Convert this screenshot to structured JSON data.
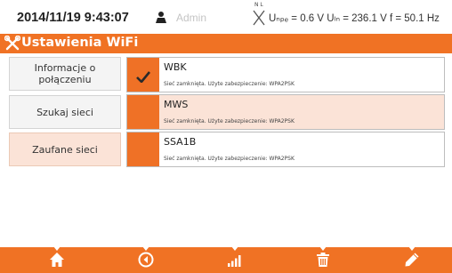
{
  "status": {
    "datetime": "2014/11/19 9:43:07",
    "user": "Admin",
    "net_symbol": "N L",
    "readings": "Uₙₚₑ = 0.6 V Uₗₙ = 236.1 V f = 50.1 Hz"
  },
  "header": {
    "title": "Ustawienia WiFi",
    "icon": "tools-icon"
  },
  "sidebar": {
    "items": [
      {
        "label": "Informacje o połączeniu",
        "active": false
      },
      {
        "label": "Szukaj sieci",
        "active": false
      },
      {
        "label": "Zaufane sieci",
        "active": true
      }
    ]
  },
  "networks": [
    {
      "name": "WBK",
      "description": "Sieć zamknięta. Użyte zabezpieczenie: WPA2PSK",
      "connected": true,
      "selected": false
    },
    {
      "name": "MWS",
      "description": "Sieć zamknięta. Użyte zabezpieczenie: WPA2PSK",
      "connected": false,
      "selected": true
    },
    {
      "name": "SSA1B",
      "description": "Sieć zamknięta. Użyte zabezpieczenie: WPA2PSK",
      "connected": false,
      "selected": false
    }
  ],
  "toolbar": {
    "buttons": [
      "home-icon",
      "back-icon",
      "signal-icon",
      "trash-icon",
      "edit-icon"
    ]
  },
  "colors": {
    "accent": "#f07224",
    "selected_row": "#fbe3d7"
  }
}
